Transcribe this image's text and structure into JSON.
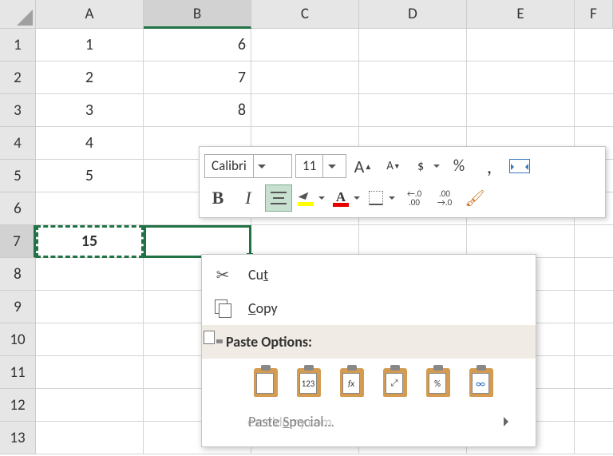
{
  "columns": [
    "A",
    "B",
    "C",
    "D",
    "E",
    "F"
  ],
  "rows": [
    "1",
    "2",
    "3",
    "4",
    "5",
    "6",
    "7",
    "8",
    "9",
    "10",
    "11",
    "12",
    "13"
  ],
  "activeColumn": 1,
  "activeRow": 6,
  "cells": {
    "A1": "1",
    "A2": "2",
    "A3": "3",
    "A4": "4",
    "A5": "5",
    "A7": "15",
    "B1": "6",
    "B2": "7",
    "B3": "8"
  },
  "miniToolbar": {
    "font": "Calibri",
    "size": "11",
    "increaseFont": "A",
    "decreaseFont": "A",
    "currency": "$",
    "percent": "%",
    "comma": ",",
    "bold": "B",
    "italic": "I",
    "fontColorLetter": "A",
    "incDecimal": "←.0\n.00",
    "decDecimal": ".00\n→.0"
  },
  "contextMenu": {
    "cut": "Cut",
    "cutKey": "t",
    "copy": "Copy",
    "copyKey": "C",
    "pasteOptions": "Paste Options:",
    "pasteSpecial": "Paste Special...",
    "pasteSpecialKey": "S",
    "pasteButtons": {
      "paste": "",
      "values": "123",
      "formulas": "fx",
      "transpose": "⤢",
      "formatting": "%",
      "link": "∞"
    }
  },
  "watermark": "exceldemy.com"
}
